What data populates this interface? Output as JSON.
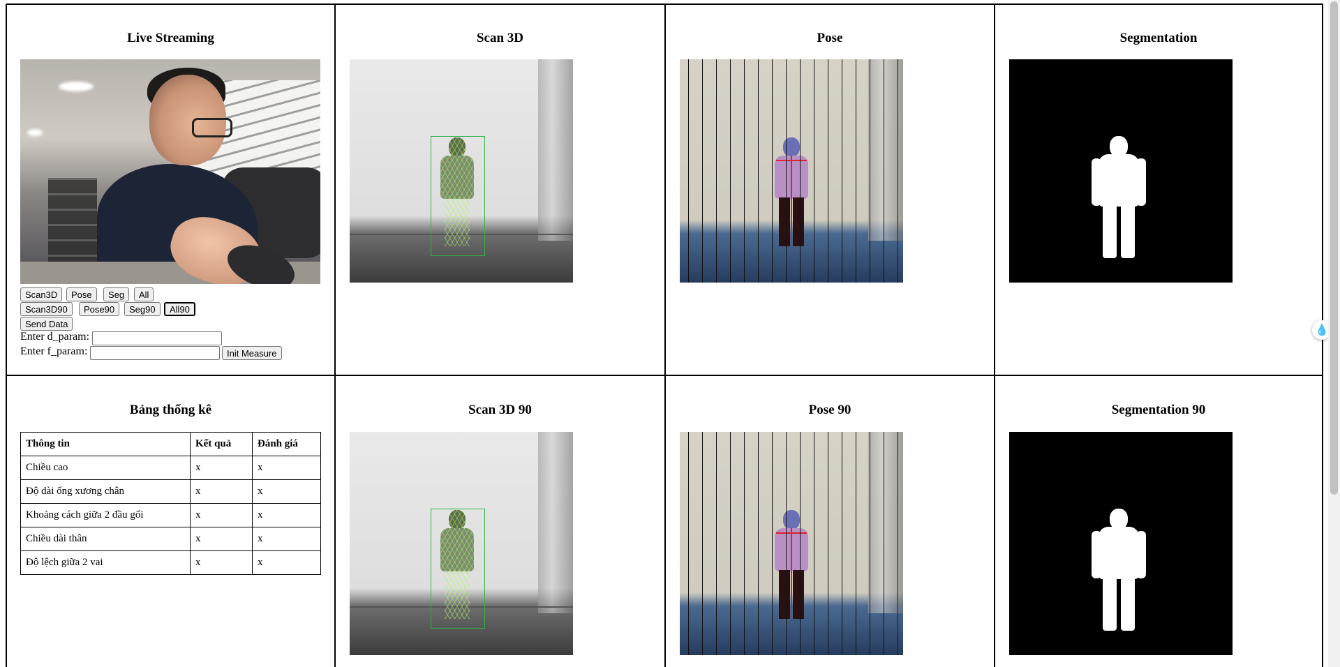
{
  "panels": {
    "live": {
      "title": "Live Streaming"
    },
    "scan3d": {
      "title": "Scan 3D"
    },
    "pose": {
      "title": "Pose"
    },
    "seg": {
      "title": "Segmentation"
    },
    "stats": {
      "title": "Bảng thống kê"
    },
    "scan3d90": {
      "title": "Scan 3D 90"
    },
    "pose90": {
      "title": "Pose 90"
    },
    "seg90": {
      "title": "Segmentation 90"
    }
  },
  "buttons": {
    "scan3d": "Scan3D",
    "pose": "Pose",
    "seg": "Seg",
    "all": "All",
    "scan3d90": "Scan3D90",
    "pose90": "Pose90",
    "seg90": "Seg90",
    "all90": "All90",
    "send": "Send Data",
    "init": "Init Measure"
  },
  "inputs": {
    "d_label": "Enter d_param:",
    "d_value": "",
    "f_label": "Enter f_param:",
    "f_value": ""
  },
  "table": {
    "headers": [
      "Thông tin",
      "Kết quả",
      "Đánh giá"
    ],
    "rows": [
      [
        "Chiều cao",
        "x",
        "x"
      ],
      [
        "Độ dài ống xương chân",
        "x",
        "x"
      ],
      [
        "Khoảng cách giữa 2 đầu gối",
        "x",
        "x"
      ],
      [
        "Chiều dài thân",
        "x",
        "x"
      ],
      [
        "Độ lệch giữa 2 vai",
        "x",
        "x"
      ]
    ]
  },
  "icons": {
    "floating_widget": "water-drop-sparkle-icon"
  },
  "colors": {
    "border": "#000000",
    "segmentation_bg": "#000000",
    "mesh": "#2fb24a",
    "skeleton": "#e0202a"
  }
}
